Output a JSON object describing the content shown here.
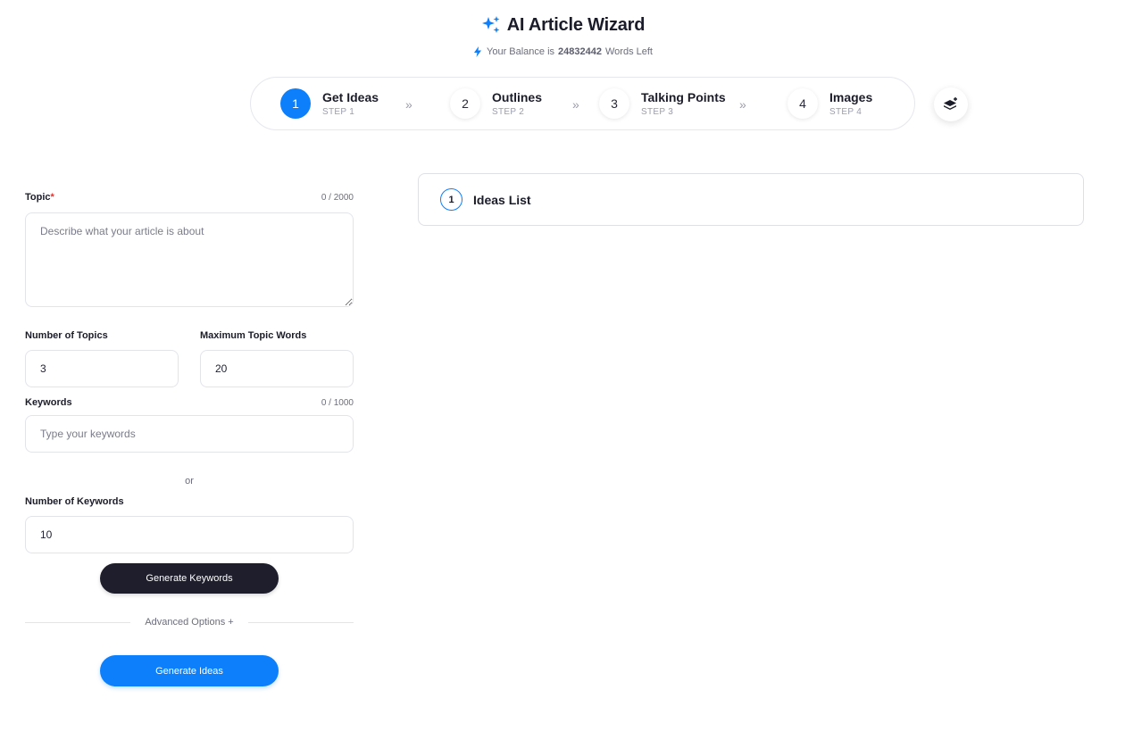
{
  "header": {
    "title": "AI Article Wizard",
    "balance_prefix": "Your Balance is",
    "balance_value": "24832442",
    "balance_suffix": "Words Left"
  },
  "steps": [
    {
      "number": "1",
      "name": "Get Ideas",
      "sub": "STEP 1",
      "active": true
    },
    {
      "number": "2",
      "name": "Outlines",
      "sub": "STEP 2",
      "active": false
    },
    {
      "number": "3",
      "name": "Talking Points",
      "sub": "STEP 3",
      "active": false
    },
    {
      "number": "4",
      "name": "Images",
      "sub": "STEP 4",
      "active": false
    }
  ],
  "chevron": "»",
  "form": {
    "topic_label": "Topic",
    "topic_required": "*",
    "topic_counter": "0 / 2000",
    "topic_placeholder": "Describe what your article is about",
    "num_topics_label": "Number of Topics",
    "num_topics_value": "3",
    "max_words_label": "Maximum Topic Words",
    "max_words_value": "20",
    "keywords_label": "Keywords",
    "keywords_counter": "0 / 1000",
    "keywords_placeholder": "Type your keywords",
    "or_text": "or",
    "num_keywords_label": "Number of Keywords",
    "num_keywords_value": "10",
    "generate_keywords": "Generate Keywords",
    "advanced_options": "Advanced Options +",
    "generate_ideas": "Generate Ideas"
  },
  "ideas_panel": {
    "number": "1",
    "title": "Ideas List"
  },
  "colors": {
    "accent": "#0d7ffb",
    "dark_button": "#1e1e2c",
    "required": "#e5312d"
  }
}
